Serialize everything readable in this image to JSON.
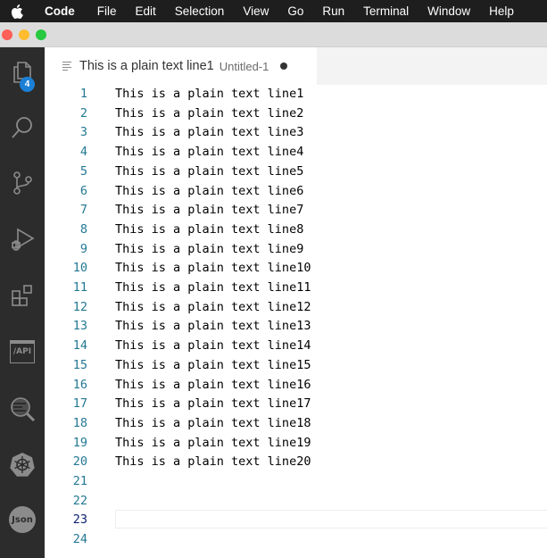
{
  "menubar": {
    "app": "Code",
    "items": [
      "File",
      "Edit",
      "Selection",
      "View",
      "Go",
      "Run",
      "Terminal",
      "Window",
      "Help"
    ]
  },
  "activity_bar": {
    "icons": [
      "explorer-icon",
      "search-icon",
      "source-control-icon",
      "run-debug-icon",
      "extensions-icon",
      "api-icon",
      "inspect-icon",
      "kubernetes-icon",
      "json-icon"
    ],
    "explorer_badge": "4",
    "api_label": "/API",
    "json_label": "Json"
  },
  "tab": {
    "title": "This is a plain text line1",
    "description": "Untitled-1",
    "dirty": true
  },
  "editor": {
    "active_line": 23,
    "lines": [
      {
        "n": "1",
        "text": "This is a plain text line1"
      },
      {
        "n": "2",
        "text": "This is a plain text line2"
      },
      {
        "n": "3",
        "text": "This is a plain text line3"
      },
      {
        "n": "4",
        "text": "This is a plain text line4"
      },
      {
        "n": "5",
        "text": "This is a plain text line5"
      },
      {
        "n": "6",
        "text": "This is a plain text line6"
      },
      {
        "n": "7",
        "text": "This is a plain text line7"
      },
      {
        "n": "8",
        "text": "This is a plain text line8"
      },
      {
        "n": "9",
        "text": "This is a plain text line9"
      },
      {
        "n": "10",
        "text": "This is a plain text line10"
      },
      {
        "n": "11",
        "text": "This is a plain text line11"
      },
      {
        "n": "12",
        "text": "This is a plain text line12"
      },
      {
        "n": "13",
        "text": "This is a plain text line13"
      },
      {
        "n": "14",
        "text": "This is a plain text line14"
      },
      {
        "n": "15",
        "text": "This is a plain text line15"
      },
      {
        "n": "16",
        "text": "This is a plain text line16"
      },
      {
        "n": "17",
        "text": "This is a plain text line17"
      },
      {
        "n": "18",
        "text": "This is a plain text line18"
      },
      {
        "n": "19",
        "text": "This is a plain text line19"
      },
      {
        "n": "20",
        "text": "This is a plain text line20"
      },
      {
        "n": "21",
        "text": ""
      },
      {
        "n": "22",
        "text": ""
      },
      {
        "n": "23",
        "text": ""
      },
      {
        "n": "24",
        "text": ""
      }
    ]
  },
  "colors": {
    "activity_bar": "#2c2c2c",
    "badge": "#1b7fd6",
    "line_number": "#237893",
    "active_line_number": "#0b216f"
  }
}
